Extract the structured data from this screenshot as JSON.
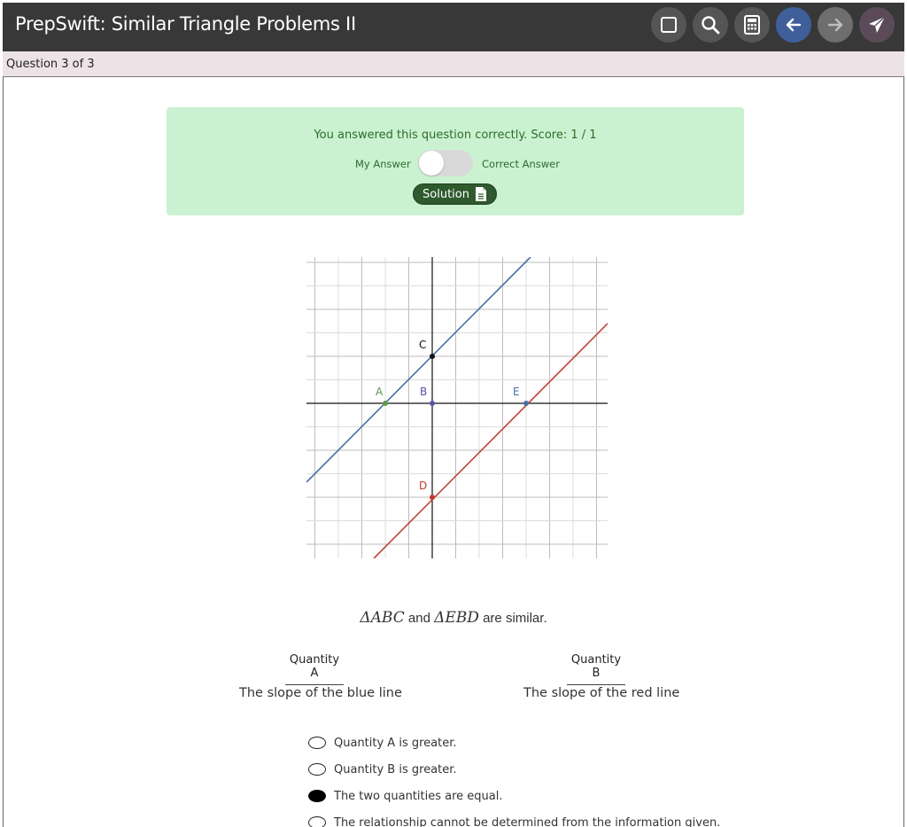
{
  "header": {
    "title": "PrepSwift: Similar Triangle Problems II",
    "buttons": [
      {
        "name": "flag-button",
        "icon": "square-icon"
      },
      {
        "name": "search-button",
        "icon": "magnifier-icon"
      },
      {
        "name": "calculator-button",
        "icon": "calculator-icon"
      },
      {
        "name": "back-button",
        "icon": "arrow-left-icon"
      },
      {
        "name": "forward-button",
        "icon": "arrow-right-icon"
      },
      {
        "name": "submit-button",
        "icon": "paper-plane-icon"
      }
    ]
  },
  "progress": {
    "label": "Question 3 of 3"
  },
  "feedback": {
    "message": "You answered this question correctly. Score: 1 / 1",
    "my_answer_label": "My Answer",
    "correct_answer_label": "Correct Answer",
    "toggle_on": false,
    "solution_label": "Solution"
  },
  "graph": {
    "points": [
      {
        "label": "A",
        "color": "#5a9a4a"
      },
      {
        "label": "B",
        "color": "#5555aa"
      },
      {
        "label": "C",
        "color": "#111111"
      },
      {
        "label": "D",
        "color": "#c0392b"
      },
      {
        "label": "E",
        "color": "#4a6fa5"
      }
    ],
    "blue_line_color": "#4a6fa5",
    "red_line_color": "#c0453a"
  },
  "question": {
    "triangle1": "ΔABC",
    "connector": "and",
    "triangle2": "ΔEBD",
    "suffix": "are similar."
  },
  "quantities": {
    "a_header": "Quantity A",
    "a_text": "The slope of the blue line",
    "b_header": "Quantity B",
    "b_text": "The slope of the red line"
  },
  "choices": [
    {
      "label": "Quantity A is greater.",
      "selected": false
    },
    {
      "label": "Quantity B is greater.",
      "selected": false
    },
    {
      "label": "The two quantities are equal.",
      "selected": true
    },
    {
      "label": "The relationship cannot be determined from the information given.",
      "selected": false
    }
  ]
}
